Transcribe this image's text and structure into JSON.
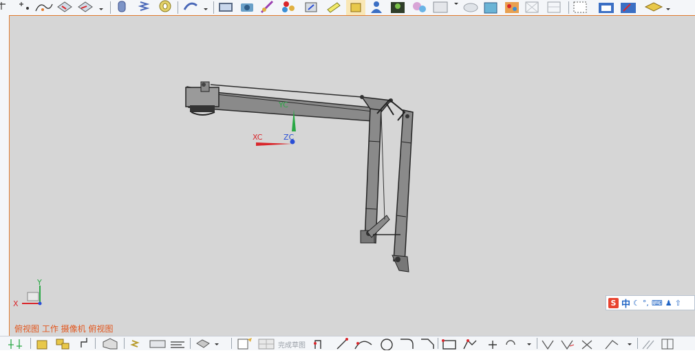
{
  "toolbar_top": {
    "icons": [
      "line-icon",
      "point-icon",
      "spline-icon",
      "surface-icon",
      "surface-extend-icon",
      "dropdown-icon",
      "cylinder-icon",
      "spring-icon",
      "coil-icon",
      "pipe-icon",
      "dropdown-icon",
      "video-icon",
      "camera-icon",
      "paint-icon",
      "colors-icon",
      "motion-icon",
      "highlight-icon",
      "box-icon",
      "user-icon",
      "scene-icon",
      "sphere-icon",
      "window-icon",
      "dropdown-icon",
      "cloud-icon",
      "cube-icon",
      "palette-icon",
      "wireframe-icon",
      "wireframe-icon",
      "frame-icon",
      "solid-view-icon",
      "edit-view-icon",
      "layer-icon",
      "dropdown-icon"
    ]
  },
  "toolbar_bottom": {
    "sketch_finish_label": "完成草图",
    "icons": [
      "axis-icon",
      "assembly-icon",
      "component-icon",
      "constraint-icon",
      "part-icon",
      "spring-icon",
      "measure-icon",
      "align-icon",
      "box-icon",
      "dropdown-icon",
      "sketch-icon",
      "grid-icon",
      "profile-icon",
      "line-icon",
      "arc-icon",
      "circle-icon",
      "fillet-icon",
      "chamfer-icon",
      "rectangle-icon",
      "polygon-icon",
      "point-icon",
      "offset-icon",
      "dropdown-icon",
      "trim-icon",
      "extend-icon",
      "mirror-icon",
      "pattern-icon",
      "dropdown-icon",
      "derive-icon",
      "constraint-icon"
    ]
  },
  "viewport": {
    "view_label": "俯视图 工作 摄像机 俯视图",
    "background": "#d6d6d6",
    "csys": {
      "xc": "XC",
      "yc": "YC",
      "zc": "ZC"
    },
    "triad": {
      "x": "X",
      "y": "Y"
    }
  },
  "ime_bar": {
    "logo": "S",
    "lang": "中",
    "glyphs": [
      "☾",
      "°,",
      "⌨",
      "♟",
      "⇧"
    ]
  },
  "colors": {
    "accent": "#e07a2e",
    "label": "#e2561d",
    "xc": "#d9262b",
    "yc": "#2aa845",
    "zc": "#2a4fd6"
  }
}
